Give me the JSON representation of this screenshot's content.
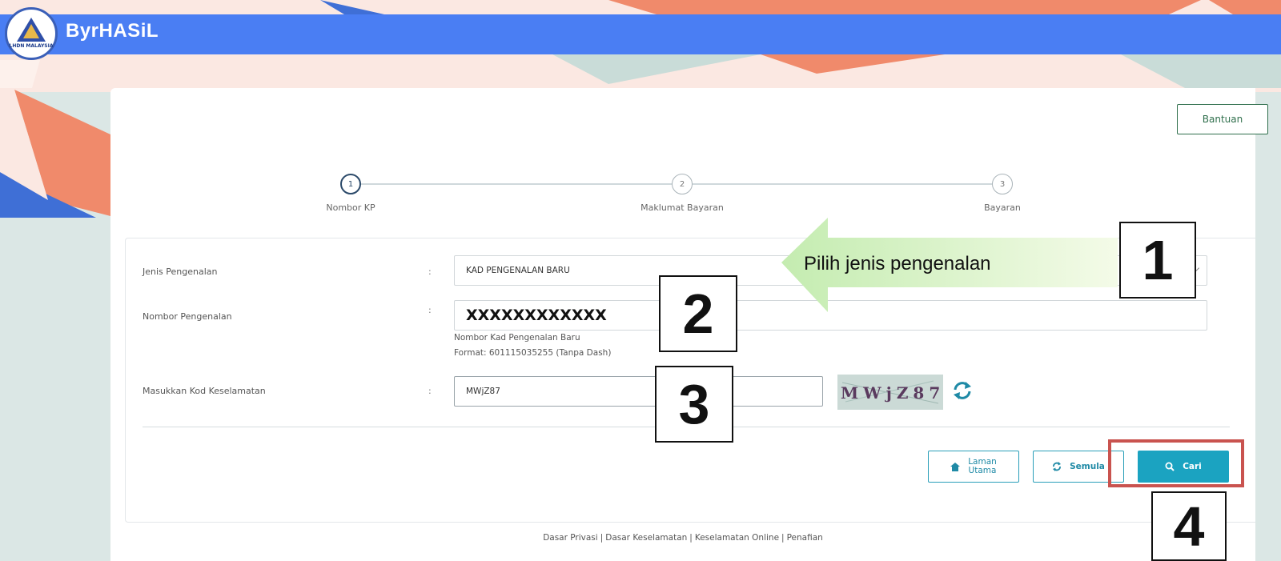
{
  "app": {
    "title": "ByrHASiL",
    "logo_text": "LHDN MALAYSIA"
  },
  "help_label": "Bantuan",
  "steps": [
    {
      "number": "1",
      "label": "Nombor KP"
    },
    {
      "number": "2",
      "label": "Maklumat Bayaran"
    },
    {
      "number": "3",
      "label": "Bayaran"
    }
  ],
  "form": {
    "colon": ":",
    "id_type": {
      "label": "Jenis Pengenalan",
      "value": "KAD PENGENALAN BARU"
    },
    "id_number": {
      "label": "Nombor Pengenalan",
      "value": "XXXXXXXXXXXX",
      "hint1": "Nombor Kad Pengenalan Baru",
      "hint2": "Format: 601115035255 (Tanpa Dash)"
    },
    "security": {
      "label": "Masukkan Kod Keselamatan",
      "value": "MWjZ87",
      "captcha": "MWjZ87"
    }
  },
  "buttons": {
    "home_line1": "Laman",
    "home_line2": "Utama",
    "reset": "Semula",
    "search": "Cari"
  },
  "annotations": {
    "arrow_text": "Pilih jenis pengenalan",
    "n1": "1",
    "n2": "2",
    "n3": "3",
    "n4": "4"
  },
  "footer": {
    "link1": "Dasar Privasi",
    "link2": "Dasar Keselamatan",
    "link3": "Keselamatan Online",
    "link4": "Penafian",
    "separator": "|"
  },
  "colors": {
    "header": "#4a7ef3",
    "accent": "#1ba3c1",
    "frame": "#c9534f",
    "arrow": "#dff5c8"
  },
  "icons": [
    "home-icon",
    "refresh-icon",
    "search-icon",
    "chevron-down-icon"
  ]
}
